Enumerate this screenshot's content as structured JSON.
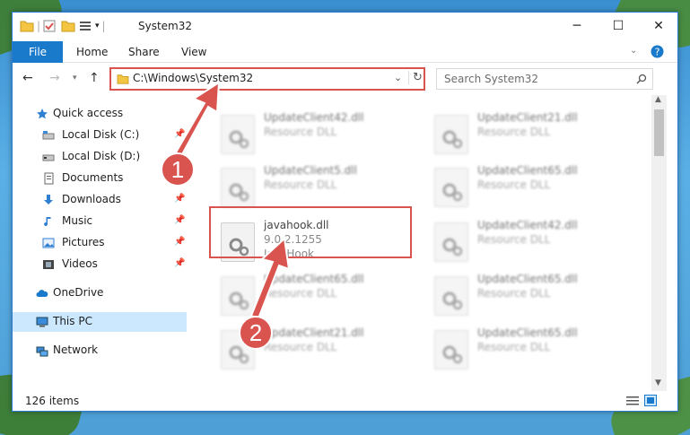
{
  "window": {
    "title": "System32",
    "controls": {
      "minimize": "─",
      "maximize": "☐",
      "close": "✕"
    }
  },
  "ribbon": {
    "tabs": [
      "File",
      "Home",
      "Share",
      "View"
    ]
  },
  "navigation": {
    "address": "C:\\Windows\\System32",
    "search_placeholder": "Search System32"
  },
  "sidebar": {
    "items": [
      {
        "label": "Quick access",
        "icon": "star-icon",
        "pinned": false
      },
      {
        "label": "Local Disk (C:)",
        "icon": "drive-icon",
        "pinned": true
      },
      {
        "label": "Local Disk (D:)",
        "icon": "drive-icon",
        "pinned": false
      },
      {
        "label": "Documents",
        "icon": "documents-icon",
        "pinned": true
      },
      {
        "label": "Downloads",
        "icon": "download-icon",
        "pinned": true
      },
      {
        "label": "Music",
        "icon": "music-icon",
        "pinned": true
      },
      {
        "label": "Pictures",
        "icon": "pictures-icon",
        "pinned": true
      },
      {
        "label": "Videos",
        "icon": "videos-icon",
        "pinned": true
      },
      {
        "label": "OneDrive",
        "icon": "cloud-icon",
        "pinned": false
      },
      {
        "label": "This PC",
        "icon": "pc-icon",
        "pinned": false,
        "selected": true
      },
      {
        "label": "Network",
        "icon": "network-icon",
        "pinned": false
      }
    ]
  },
  "files": [
    {
      "name": "UpdateClient42.dll",
      "desc": "Resource DLL",
      "col": 0,
      "row": 0
    },
    {
      "name": "UpdateClient21.dll",
      "desc": "Resource DLL",
      "col": 1,
      "row": 0
    },
    {
      "name": "UpdateClient5.dll",
      "desc": "Resource DLL",
      "col": 0,
      "row": 1
    },
    {
      "name": "UpdateClient65.dll",
      "desc": "Resource DLL",
      "col": 1,
      "row": 1
    },
    {
      "name": "javahook.dll",
      "version": "9.0.2.1255",
      "desc": "JavaHook",
      "col": 0,
      "row": 2,
      "highlighted": true
    },
    {
      "name": "UpdateClient42.dll",
      "desc": "Resource DLL",
      "col": 1,
      "row": 2
    },
    {
      "name": "UpdateClient65.dll",
      "desc": "Resource DLL",
      "col": 0,
      "row": 3
    },
    {
      "name": "UpdateClient65.dll",
      "desc": "Resource DLL",
      "col": 1,
      "row": 3
    },
    {
      "name": "UpdateClient21.dll",
      "desc": "Resource DLL",
      "col": 0,
      "row": 4
    },
    {
      "name": "UpdateClient65.dll",
      "desc": "Resource DLL",
      "col": 1,
      "row": 4
    }
  ],
  "status": {
    "item_count": "126 items"
  },
  "annotations": {
    "callout1": "1",
    "callout2": "2"
  },
  "colors": {
    "accent": "#1979ca",
    "highlight": "#d9534f",
    "selected": "#cce8ff"
  }
}
